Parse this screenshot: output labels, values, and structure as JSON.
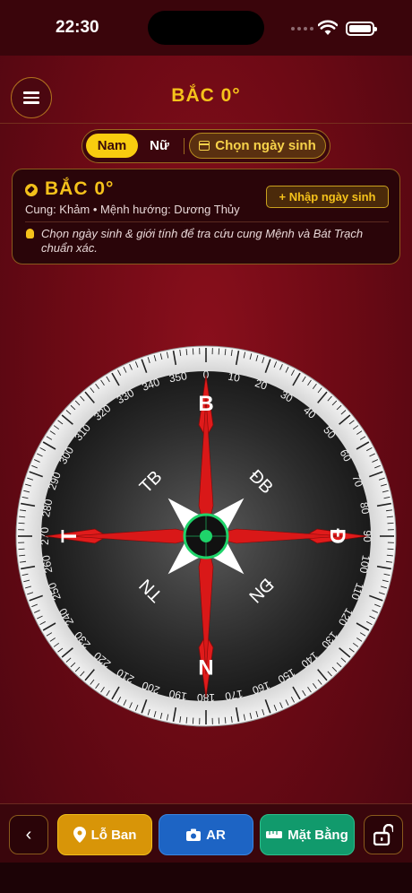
{
  "status": {
    "time": "22:30"
  },
  "header": {
    "title": "BẮC  0°"
  },
  "gender": {
    "male": "Nam",
    "female": "Nữ",
    "pick_date": "Chọn ngày sinh",
    "selected": "Nam"
  },
  "card": {
    "heading": "BẮC  0°",
    "subtitle": "Cung: Khảm  •  Mệnh hướng: Dương Thủy",
    "enter_dob": "+ Nhập ngày sinh",
    "hint": "Chọn ngày sinh & giới tính để tra cứu cung Mệnh và Bát Trạch chuẩn xác."
  },
  "compass": {
    "heading_deg": 0,
    "tick_labels": [
      "0",
      "10",
      "20",
      "30",
      "40",
      "50",
      "60",
      "70",
      "80",
      "90",
      "100",
      "110",
      "120",
      "130",
      "140",
      "150",
      "160",
      "170",
      "180",
      "190",
      "200",
      "210",
      "220",
      "230",
      "240",
      "250",
      "260",
      "270",
      "280",
      "290",
      "300",
      "310",
      "320",
      "330",
      "340",
      "350"
    ],
    "intercardinals": {
      "ne": "ĐB",
      "nw": "TB",
      "se": "ĐN",
      "sw": "TN"
    },
    "cardinals": {
      "n": "B",
      "e": "Đ",
      "s": "N",
      "w": "T"
    },
    "colors": {
      "arrow": "#e01b1b",
      "center": "#1fd36a",
      "bezel": "#f4f4f4"
    }
  },
  "toolbar": {
    "back": "‹",
    "loban": "Lỗ Ban",
    "ar": "AR",
    "floor": "Mặt Bằng"
  },
  "icons": {
    "menu": "menu-icon",
    "calendar": "calendar-icon",
    "pin": "location-pin-icon",
    "camera": "camera-icon",
    "ruler": "ruler-icon",
    "lock": "unlock-icon",
    "wifi": "wifi-icon",
    "battery": "battery-icon"
  }
}
